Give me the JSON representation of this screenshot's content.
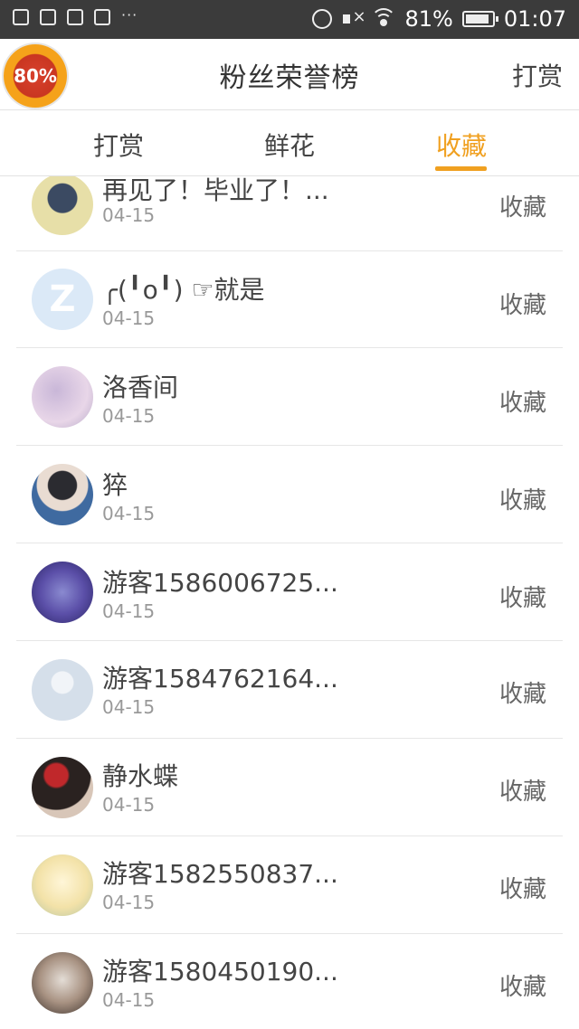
{
  "status_bar": {
    "battery": "81%",
    "time": "01:07",
    "left_icons": [
      "image-icon",
      "package-icon",
      "package-icon",
      "package-icon"
    ],
    "overflow": "···"
  },
  "header": {
    "badge": "80%",
    "title": "粉丝荣誉榜",
    "action": "打赏"
  },
  "tabs": [
    {
      "label": "打赏"
    },
    {
      "label": "鲜花"
    },
    {
      "label": "收藏"
    }
  ],
  "rows": [
    {
      "name": "再见了！毕业了！...",
      "date": "04-15",
      "action": "收藏"
    },
    {
      "name": "╭(╹o╹) ☞就是",
      "date": "04-15",
      "action": "收藏"
    },
    {
      "name": "洛香间",
      "date": "04-15",
      "action": "收藏"
    },
    {
      "name": "猝",
      "date": "04-15",
      "action": "收藏"
    },
    {
      "name": "游客1586006725...",
      "date": "04-15",
      "action": "收藏"
    },
    {
      "name": "游客1584762164...",
      "date": "04-15",
      "action": "收藏"
    },
    {
      "name": "静水蝶",
      "date": "04-15",
      "action": "收藏"
    },
    {
      "name": "游客1582550837...",
      "date": "04-15",
      "action": "收藏"
    },
    {
      "name": "游客1580450190...",
      "date": "04-15",
      "action": "收藏"
    }
  ],
  "colors": {
    "accent": "#f0a020",
    "status_bar": "#3b3b3b"
  }
}
